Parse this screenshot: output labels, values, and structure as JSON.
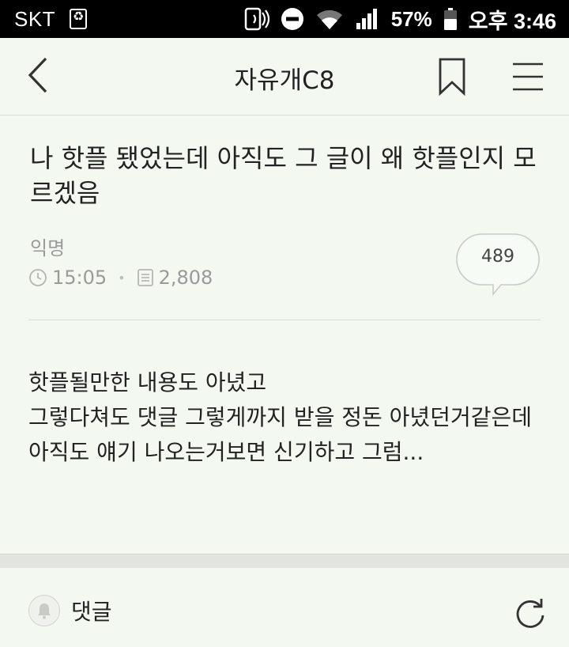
{
  "status_bar": {
    "carrier": "SKT",
    "battery": "57%",
    "time": "오후 3:46",
    "icons": [
      "recycle-icon",
      "nfc-icon",
      "do-not-disturb-icon",
      "wifi-icon",
      "signal-icon",
      "battery-icon"
    ]
  },
  "header": {
    "title": "자유개C8",
    "icons": [
      "back-arrow-icon",
      "bookmark-icon",
      "menu-icon"
    ]
  },
  "post": {
    "title": "나 핫플 됐었는데 아직도 그 글이 왜 핫플인지 모르겠음",
    "author": "익명",
    "time": "15:05",
    "views": "2,808",
    "comment_count": "489",
    "body_lines": [
      "핫플될만한 내용도 아녔고",
      "그렇다쳐도 댓글 그렇게까지 받을 정돈 아녔던거같은데",
      "아직도 얘기 나오는거보면 신기하고 그럼..."
    ]
  },
  "comment_bar": {
    "label": "댓글",
    "icons": [
      "bell-icon",
      "refresh-icon"
    ]
  },
  "colors": {
    "background": "#f3f9f0",
    "status_bar": "#000000",
    "muted_text": "#9a9a9a",
    "divider": "#d9ddd6"
  }
}
